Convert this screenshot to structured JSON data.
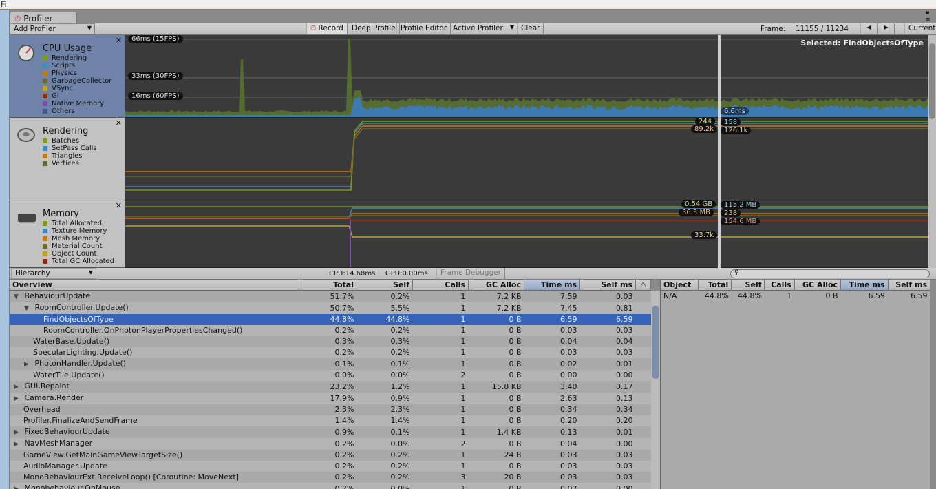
{
  "window": {
    "tab": "Profiler",
    "edge_text": "Fi"
  },
  "toolbar": {
    "add_profiler": "Add Profiler",
    "record": "Record",
    "deep_profile": "Deep Profile",
    "profile_editor": "Profile Editor",
    "active_profiler": "Active Profiler",
    "clear": "Clear",
    "frame_label": "Frame:",
    "frame_value": "11155 / 11234",
    "current": "Current"
  },
  "cpu": {
    "title": "CPU Usage",
    "legend": [
      {
        "name": "Rendering",
        "color": "#7a9a18"
      },
      {
        "name": "Scripts",
        "color": "#3d8cc4"
      },
      {
        "name": "Physics",
        "color": "#c47a14"
      },
      {
        "name": "GarbageCollector",
        "color": "#6e6a30"
      },
      {
        "name": "VSync",
        "color": "#c4a41c"
      },
      {
        "name": "Gi",
        "color": "#8a2e14"
      },
      {
        "name": "Native Memory",
        "color": "#7a50a8"
      },
      {
        "name": "Others",
        "color": "#3d5e8c"
      }
    ],
    "grid_labels": [
      "66ms (15FPS)",
      "33ms (30FPS)",
      "16ms (60FPS)"
    ],
    "selected": "Selected: FindObjectsOfType",
    "value_label": "6.6ms"
  },
  "rendering": {
    "title": "Rendering",
    "legend": [
      {
        "name": "Batches",
        "color": "#7a9a18"
      },
      {
        "name": "SetPass Calls",
        "color": "#3d8cc4"
      },
      {
        "name": "Triangles",
        "color": "#c47a14"
      },
      {
        "name": "Vertices",
        "color": "#6e6a30"
      }
    ],
    "labels_left": [
      "244",
      "89.2k"
    ],
    "labels_right": [
      "158",
      "126.1k"
    ]
  },
  "memory": {
    "title": "Memory",
    "legend": [
      {
        "name": "Total Allocated",
        "color": "#7a9a18"
      },
      {
        "name": "Texture Memory",
        "color": "#3d8cc4"
      },
      {
        "name": "Mesh Memory",
        "color": "#c47a14"
      },
      {
        "name": "Material Count",
        "color": "#6e6a30"
      },
      {
        "name": "Object Count",
        "color": "#c4a41c"
      },
      {
        "name": "Total GC Allocated",
        "color": "#8a2e14"
      }
    ],
    "labels_left": [
      "0.54 GB",
      "36.3 MB",
      "33.7k"
    ],
    "labels_right": [
      "115.2 MB",
      "238",
      "154.6 MB"
    ]
  },
  "subbar": {
    "view": "Hierarchy",
    "cpu": "CPU:14.68ms",
    "gpu": "GPU:0.00ms",
    "frame_debugger": "Frame Debugger"
  },
  "table": {
    "columns": [
      "Overview",
      "Total",
      "Self",
      "Calls",
      "GC Alloc",
      "Time ms",
      "Self ms"
    ],
    "rows": [
      {
        "name": "BehaviourUpdate",
        "indent": 0,
        "exp": "open",
        "v": [
          "51.7%",
          "0.2%",
          "1",
          "7.2 KB",
          "7.59",
          "0.03"
        ]
      },
      {
        "name": "RoomController.Update()",
        "indent": 1,
        "exp": "open",
        "v": [
          "50.7%",
          "5.5%",
          "1",
          "7.2 KB",
          "7.45",
          "0.81"
        ]
      },
      {
        "name": "FindObjectsOfType",
        "indent": 2,
        "exp": "",
        "sel": true,
        "v": [
          "44.8%",
          "44.8%",
          "1",
          "0 B",
          "6.59",
          "6.59"
        ]
      },
      {
        "name": "RoomController.OnPhotonPlayerPropertiesChanged()",
        "indent": 2,
        "exp": "",
        "v": [
          "0.2%",
          "0.2%",
          "1",
          "0 B",
          "0.03",
          "0.03"
        ]
      },
      {
        "name": "WaterBase.Update()",
        "indent": 1,
        "exp": "",
        "v": [
          "0.3%",
          "0.3%",
          "1",
          "0 B",
          "0.04",
          "0.04"
        ]
      },
      {
        "name": "SpecularLighting.Update()",
        "indent": 1,
        "exp": "",
        "v": [
          "0.2%",
          "0.2%",
          "1",
          "0 B",
          "0.03",
          "0.03"
        ]
      },
      {
        "name": "PhotonHandler.Update()",
        "indent": 1,
        "exp": "closed",
        "v": [
          "0.1%",
          "0.1%",
          "1",
          "0 B",
          "0.02",
          "0.01"
        ]
      },
      {
        "name": "WaterTile.Update()",
        "indent": 1,
        "exp": "",
        "v": [
          "0.0%",
          "0.0%",
          "2",
          "0 B",
          "0.00",
          "0.00"
        ]
      },
      {
        "name": "GUI.Repaint",
        "indent": 0,
        "exp": "closed",
        "v": [
          "23.2%",
          "1.2%",
          "1",
          "15.8 KB",
          "3.40",
          "0.17"
        ]
      },
      {
        "name": "Camera.Render",
        "indent": 0,
        "exp": "closed",
        "v": [
          "17.9%",
          "0.9%",
          "1",
          "0 B",
          "2.63",
          "0.13"
        ]
      },
      {
        "name": "Overhead",
        "indent": 0,
        "exp": "",
        "v": [
          "2.3%",
          "2.3%",
          "1",
          "0 B",
          "0.34",
          "0.34"
        ]
      },
      {
        "name": "Profiler.FinalizeAndSendFrame",
        "indent": 0,
        "exp": "",
        "v": [
          "1.4%",
          "1.4%",
          "1",
          "0 B",
          "0.20",
          "0.20"
        ]
      },
      {
        "name": "FixedBehaviourUpdate",
        "indent": 0,
        "exp": "closed",
        "v": [
          "0.9%",
          "0.1%",
          "1",
          "1.4 KB",
          "0.13",
          "0.01"
        ]
      },
      {
        "name": "NavMeshManager",
        "indent": 0,
        "exp": "closed",
        "v": [
          "0.2%",
          "0.0%",
          "2",
          "0 B",
          "0.04",
          "0.00"
        ]
      },
      {
        "name": "GameView.GetMainGameViewTargetSize()",
        "indent": 0,
        "exp": "",
        "v": [
          "0.2%",
          "0.2%",
          "1",
          "24 B",
          "0.03",
          "0.03"
        ]
      },
      {
        "name": "AudioManager.Update",
        "indent": 0,
        "exp": "",
        "v": [
          "0.2%",
          "0.2%",
          "1",
          "0 B",
          "0.03",
          "0.03"
        ]
      },
      {
        "name": "MonoBehaviourExt.ReceiveLoop() [Coroutine: MoveNext]",
        "indent": 0,
        "exp": "",
        "v": [
          "0.2%",
          "0.2%",
          "3",
          "20 B",
          "0.03",
          "0.03"
        ]
      },
      {
        "name": "Monobehaviour.OnMouse",
        "indent": 0,
        "exp": "closed",
        "v": [
          "0.2%",
          "0.0%",
          "1",
          "0 B",
          "0.02",
          "0.00"
        ]
      }
    ]
  },
  "details": {
    "columns": [
      "Object",
      "Total",
      "Self",
      "Calls",
      "GC Alloc",
      "Time ms",
      "Self ms"
    ],
    "rows": [
      [
        "N/A",
        "44.8%",
        "44.8%",
        "1",
        "0 B",
        "6.59",
        "6.59"
      ]
    ]
  },
  "search": {
    "placeholder": ""
  }
}
